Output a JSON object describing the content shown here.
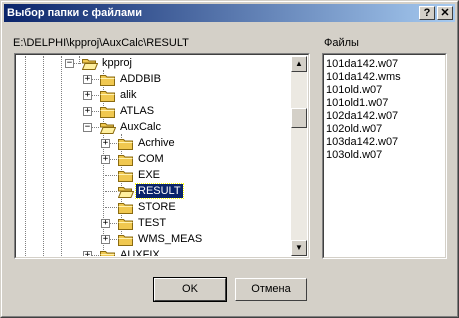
{
  "window": {
    "title": "Выбор папки с файлами",
    "help_button": "?",
    "close_button": "✕"
  },
  "current_path": "E:\\DELPHI\\kpproj\\AuxCalc\\RESULT",
  "files_label": "Файлы",
  "tree": {
    "items": [
      {
        "label": "kpproj",
        "expander": "−"
      },
      {
        "label": "ADDBIB",
        "expander": "+"
      },
      {
        "label": "alik",
        "expander": "+"
      },
      {
        "label": "ATLAS",
        "expander": "+"
      },
      {
        "label": "AuxCalc",
        "expander": "−"
      },
      {
        "label": "Acrhive",
        "expander": "+"
      },
      {
        "label": "COM",
        "expander": "+"
      },
      {
        "label": "EXE",
        "expander": ""
      },
      {
        "label": "RESULT",
        "expander": "",
        "selected": true
      },
      {
        "label": "STORE",
        "expander": ""
      },
      {
        "label": "TEST",
        "expander": "+"
      },
      {
        "label": "WMS_MEAS",
        "expander": "+"
      },
      {
        "label": "AUXFIX",
        "expander": "+"
      }
    ],
    "scroll_up": "▲",
    "scroll_down": "▼"
  },
  "files": [
    "101da142.w07",
    "101da142.wms",
    "101old.w07",
    "101old1.w07",
    "102da142.w07",
    "102old.w07",
    "103da142.w07",
    "103old.w07"
  ],
  "buttons": {
    "ok": "OK",
    "cancel": "Отмена"
  }
}
